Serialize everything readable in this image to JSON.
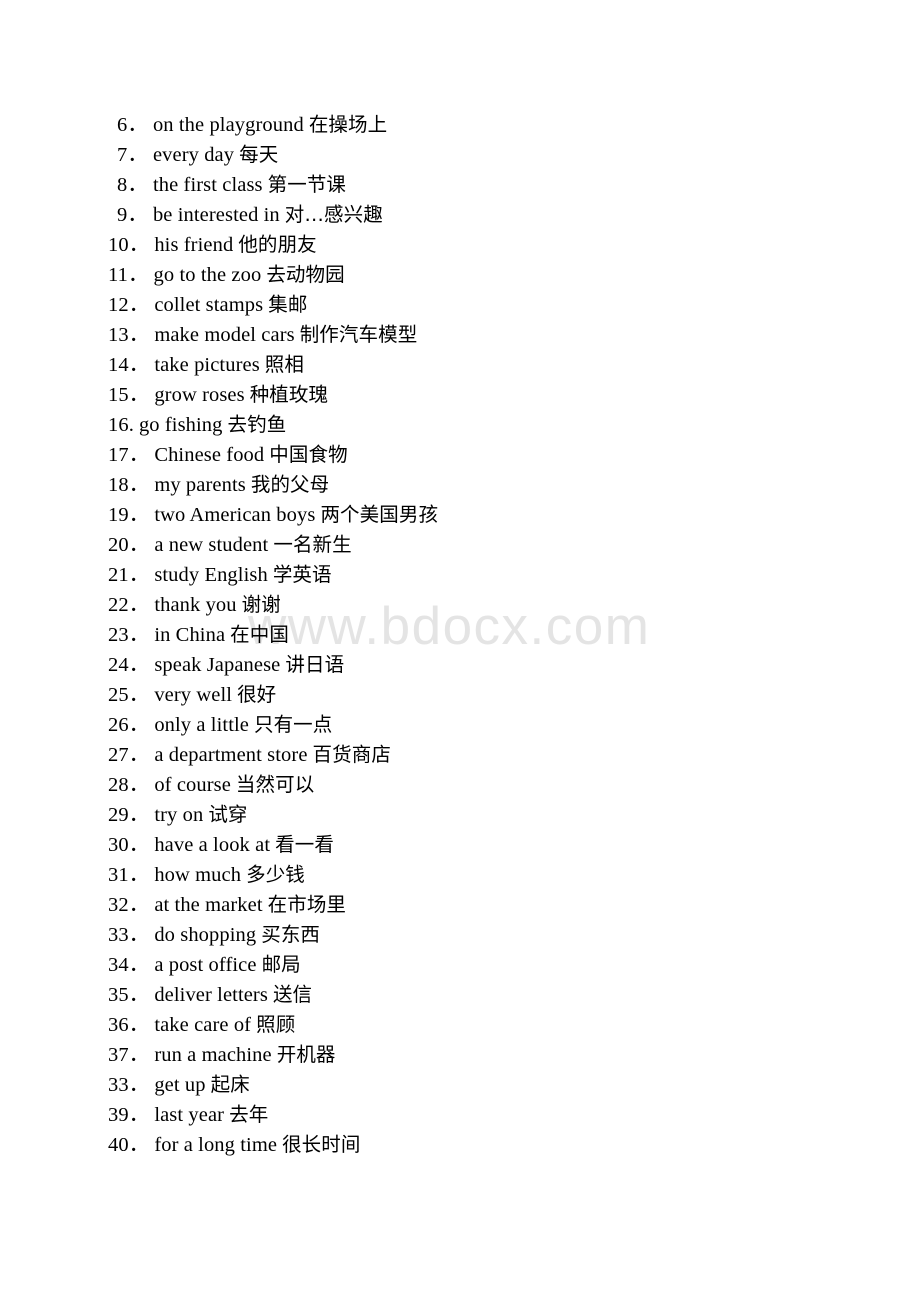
{
  "document": {
    "type": "vocabulary-list",
    "background_color": "#ffffff",
    "text_color": "#000000"
  },
  "watermark": {
    "text": "www.bdocx.com",
    "color": "#e4e4e4"
  },
  "list": {
    "items": [
      {
        "number": "6．",
        "english": "on the playground",
        "chinese": "在操场上"
      },
      {
        "number": "7．",
        "english": "every day",
        "chinese": "每天"
      },
      {
        "number": "8．",
        "english": "the first class",
        "chinese": "第一节课"
      },
      {
        "number": "9．",
        "english": "be interested in",
        "chinese": "对…感兴趣"
      },
      {
        "number": "10．",
        "english": "his friend",
        "chinese": "他的朋友"
      },
      {
        "number": "11．",
        "english": "go to the zoo",
        "chinese": "去动物园"
      },
      {
        "number": "12．",
        "english": "collet stamps",
        "chinese": "集邮"
      },
      {
        "number": "13．",
        "english": "make model cars",
        "chinese": "制作汽车模型"
      },
      {
        "number": "14．",
        "english": "take pictures",
        "chinese": "照相"
      },
      {
        "number": "15．",
        "english": "grow roses",
        "chinese": "种植玫瑰"
      },
      {
        "number": "16.",
        "english": "go fishing",
        "chinese": "去钓鱼"
      },
      {
        "number": "17．",
        "english": "Chinese food",
        "chinese": "中国食物"
      },
      {
        "number": "18．",
        "english": "my parents",
        "chinese": "我的父母"
      },
      {
        "number": "19．",
        "english": "two American boys",
        "chinese": "两个美国男孩"
      },
      {
        "number": "20．",
        "english": "a new student",
        "chinese": "一名新生"
      },
      {
        "number": "21．",
        "english": "study English",
        "chinese": "学英语"
      },
      {
        "number": "22．",
        "english": "thank you",
        "chinese": "谢谢"
      },
      {
        "number": "23．",
        "english": "in China",
        "chinese": "在中国"
      },
      {
        "number": "24．",
        "english": "speak Japanese",
        "chinese": "讲日语"
      },
      {
        "number": "25．",
        "english": "very well",
        "chinese": "很好"
      },
      {
        "number": "26．",
        "english": "only a little",
        "chinese": "只有一点"
      },
      {
        "number": "27．",
        "english": "a department store",
        "chinese": "百货商店"
      },
      {
        "number": "28．",
        "english": "of course",
        "chinese": "当然可以"
      },
      {
        "number": "29．",
        "english": "try on",
        "chinese": "试穿"
      },
      {
        "number": "30．",
        "english": "have a look at",
        "chinese": "看一看"
      },
      {
        "number": "31．",
        "english": "how much",
        "chinese": "多少钱"
      },
      {
        "number": "32．",
        "english": "at the market",
        "chinese": "在市场里"
      },
      {
        "number": "33．",
        "english": "do shopping",
        "chinese": "买东西"
      },
      {
        "number": "34．",
        "english": "a post office",
        "chinese": "邮局"
      },
      {
        "number": "35．",
        "english": "deliver letters",
        "chinese": "送信"
      },
      {
        "number": "36．",
        "english": "take care of",
        "chinese": "照顾"
      },
      {
        "number": "37．",
        "english": "run a machine",
        "chinese": "开机器"
      },
      {
        "number": "33．",
        "english": "get up",
        "chinese": "起床"
      },
      {
        "number": "39．",
        "english": "last year",
        "chinese": "去年"
      },
      {
        "number": "40．",
        "english": "for a long time",
        "chinese": "很长时间"
      }
    ]
  }
}
